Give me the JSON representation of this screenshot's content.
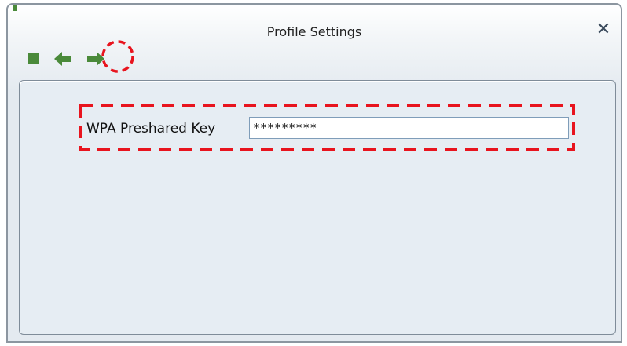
{
  "window": {
    "title": "Profile Settings",
    "close_glyph": "✕"
  },
  "toolbar": {
    "buttons": [
      {
        "icon": "stop-square-icon",
        "color": "#4a8a3a"
      },
      {
        "icon": "back-arrow-icon",
        "color": "#4a8a3a"
      },
      {
        "icon": "next-arrow-icon",
        "color": "#4a8a3a"
      }
    ]
  },
  "form": {
    "wpa_label": "WPA Preshared Key",
    "wpa_value": "*********"
  },
  "annotations": {
    "highlight_color": "#e8141e"
  }
}
